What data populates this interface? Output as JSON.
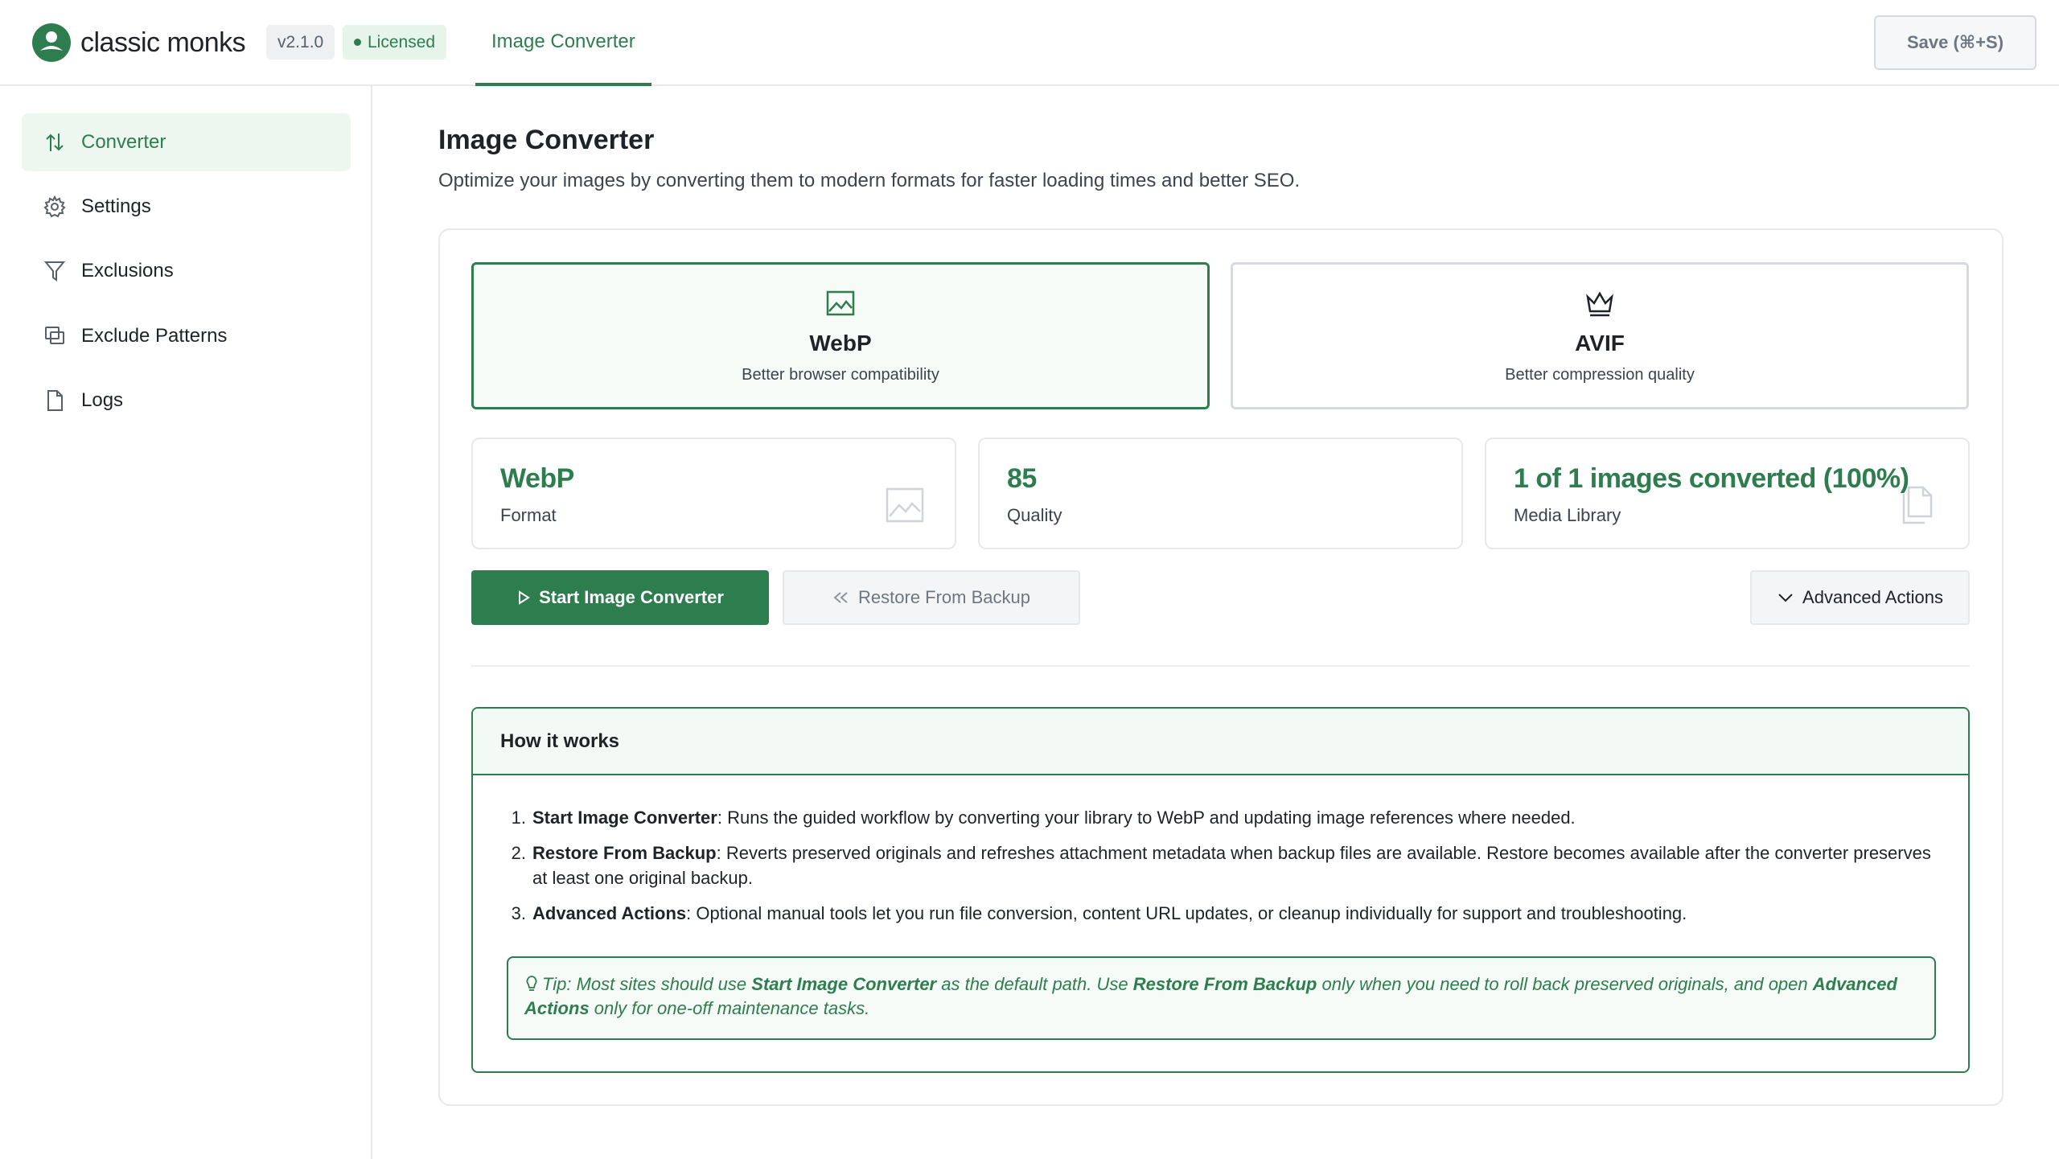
{
  "app": {
    "brand": "classic monks",
    "version": "v2.1.0",
    "license_status": "Licensed",
    "active_tab": "Image Converter",
    "save_label": "Save (⌘+S)"
  },
  "sidebar": {
    "items": [
      {
        "label": "Converter",
        "icon": "converter-icon",
        "active": true
      },
      {
        "label": "Settings",
        "icon": "gear-icon",
        "active": false
      },
      {
        "label": "Exclusions",
        "icon": "filter-icon",
        "active": false
      },
      {
        "label": "Exclude Patterns",
        "icon": "copy-icon",
        "active": false
      },
      {
        "label": "Logs",
        "icon": "file-icon",
        "active": false
      }
    ]
  },
  "main": {
    "title": "Image Converter",
    "description": "Optimize your images by converting them to modern formats for faster loading times and better SEO.",
    "formats": [
      {
        "name": "WebP",
        "description": "Better browser compatibility",
        "icon": "image-icon",
        "selected": true
      },
      {
        "name": "AVIF",
        "description": "Better compression quality",
        "icon": "crown-icon",
        "selected": false
      }
    ],
    "stats": [
      {
        "value": "WebP",
        "label": "Format",
        "icon": "image-icon"
      },
      {
        "value": "85",
        "label": "Quality",
        "icon": ""
      },
      {
        "value": "1 of 1 images converted (100%)",
        "label": "Media Library",
        "icon": "files-icon"
      }
    ],
    "actions": {
      "start": "Start Image Converter",
      "restore": "Restore From Backup",
      "advanced": "Advanced Actions"
    },
    "how_it_works": {
      "title": "How it works",
      "steps": [
        {
          "num": "1.",
          "term": "Start Image Converter",
          "text": ": Runs the guided workflow by converting your library to WebP and updating image references where needed."
        },
        {
          "num": "2.",
          "term": "Restore From Backup",
          "text": ": Reverts preserved originals and refreshes attachment metadata when backup files are available. Restore becomes available after the converter preserves at least one original backup."
        },
        {
          "num": "3.",
          "term": "Advanced Actions",
          "text": ": Optional manual tools let you run file conversion, content URL updates, or cleanup individually for support and troubleshooting."
        }
      ],
      "tip": {
        "prefix": "Tip: Most sites should use ",
        "term1": "Start Image Converter",
        "mid1": " as the default path. Use ",
        "term2": "Restore From Backup",
        "mid2": " only when you need to roll back preserved originals, and open ",
        "term3": "Advanced Actions",
        "suffix": " only for one-off maintenance tasks."
      }
    }
  },
  "colors": {
    "accent": "#2e7d4f",
    "accent_light": "#f3f9f4",
    "border": "#e6e8eb",
    "text": "#1f2328"
  }
}
